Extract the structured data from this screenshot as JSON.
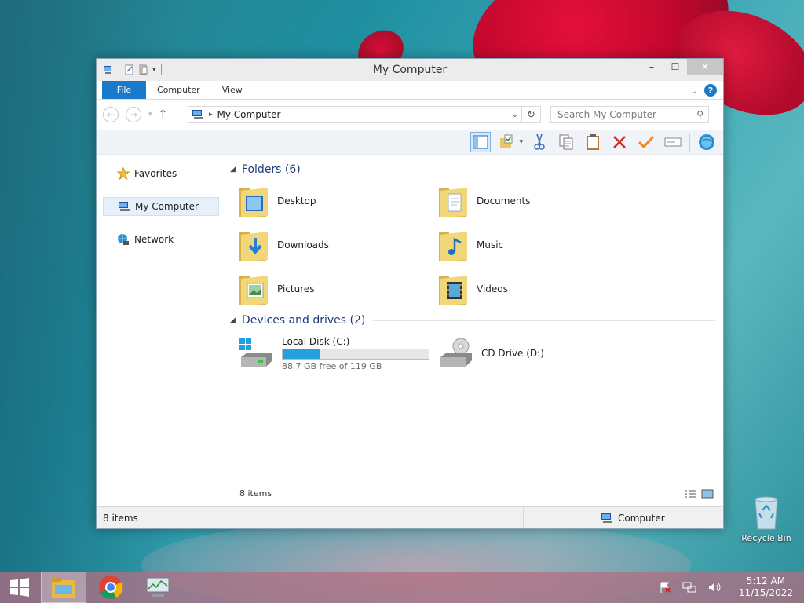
{
  "window": {
    "title": "My Computer",
    "controls": {
      "minimize": "–",
      "maximize": "☐",
      "close": "✕"
    }
  },
  "ribbon": {
    "tabs": [
      {
        "label": "File"
      },
      {
        "label": "Computer"
      },
      {
        "label": "View"
      }
    ],
    "help_label": "?"
  },
  "address": {
    "path": "My Computer",
    "search_placeholder": "Search My Computer"
  },
  "navpane": {
    "items": [
      {
        "label": "Favorites",
        "icon": "star-icon"
      },
      {
        "label": "My Computer",
        "icon": "computer-icon",
        "selected": true
      },
      {
        "label": "Network",
        "icon": "network-icon"
      }
    ]
  },
  "content": {
    "folders_group": "Folders (6)",
    "folders": [
      {
        "name": "Desktop",
        "icon": "desktop-folder-icon"
      },
      {
        "name": "Documents",
        "icon": "documents-folder-icon"
      },
      {
        "name": "Downloads",
        "icon": "downloads-folder-icon"
      },
      {
        "name": "Music",
        "icon": "music-folder-icon"
      },
      {
        "name": "Pictures",
        "icon": "pictures-folder-icon"
      },
      {
        "name": "Videos",
        "icon": "videos-folder-icon"
      }
    ],
    "drives_group": "Devices and drives (2)",
    "drives": [
      {
        "name": "Local Disk (C:)",
        "free": "88.7 GB free of 119 GB",
        "used_fraction": 0.255,
        "icon": "hard-drive-icon"
      },
      {
        "name": "CD Drive (D:)",
        "icon": "cd-drive-icon"
      }
    ],
    "item_count": "8 items"
  },
  "statusbar": {
    "items": "8 items",
    "location": "Computer"
  },
  "desktop": {
    "recycle_bin": "Recycle Bin"
  },
  "taskbar": {
    "time": "5:12 AM",
    "date": "11/15/2022"
  },
  "colors": {
    "accent": "#1979ca",
    "progress": "#26a0da",
    "group_header": "#1e3a7b"
  }
}
